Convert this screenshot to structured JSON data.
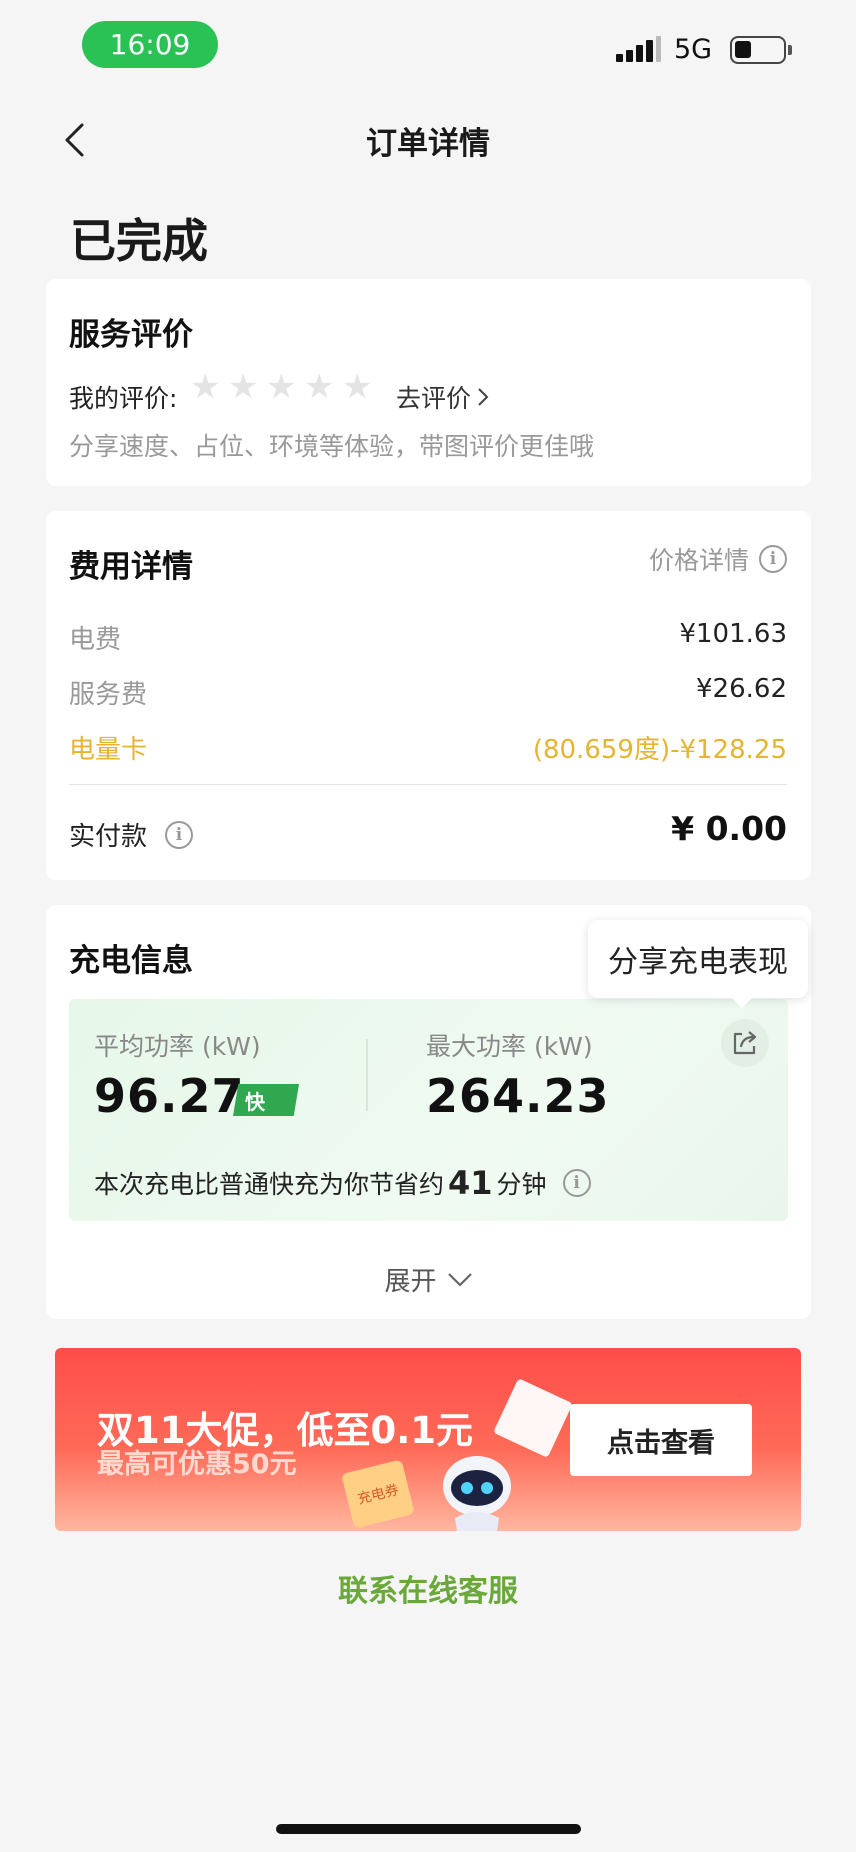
{
  "status_bar": {
    "time": "16:09",
    "network": "5G",
    "battery_level": 0.25
  },
  "nav": {
    "title": "订单详情",
    "back_icon": "chevron-left-icon"
  },
  "order_status": "已完成",
  "rating": {
    "title": "服务评价",
    "label": "我的评价:",
    "stars_filled": 0,
    "stars_total": 5,
    "go_rate": "去评价",
    "hint": "分享速度、占位、环境等体验，带图评价更佳哦"
  },
  "fees": {
    "title": "费用详情",
    "price_detail": "价格详情",
    "rows": [
      {
        "label": "电费",
        "value": "¥101.63"
      },
      {
        "label": "服务费",
        "value": "¥26.62"
      },
      {
        "label": "电量卡",
        "value": "(80.659度)-¥128.25"
      }
    ],
    "paid_label": "实付款",
    "paid_value": "¥ 0.00"
  },
  "charge": {
    "title": "充电信息",
    "tooltip": "分享充电表现",
    "avg_label": "平均功率 (kW)",
    "avg_value": "96.27",
    "fast_badge": "快",
    "max_label": "最大功率 (kW)",
    "max_value": "264.23",
    "saving_prefix": "本次充电比普通快充为你节省约",
    "saving_minutes": "41",
    "saving_suffix": "分钟",
    "expand": "展开"
  },
  "promo": {
    "title": "双11大促，低至0.1元",
    "subtitle": "最高可优惠50元",
    "button": "点击查看",
    "coupon_text": "充电券"
  },
  "contact": "联系在线客服",
  "colors": {
    "brand_green": "#2bc255",
    "accent_yellow": "#e6b431",
    "link_green": "#6aa83a",
    "promo_red": "#ff4d4a"
  }
}
